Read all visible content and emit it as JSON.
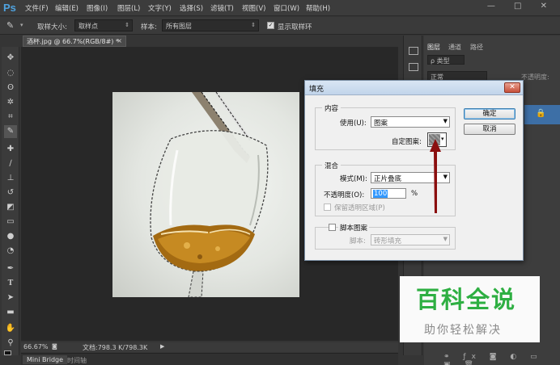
{
  "app": {
    "logo": "Ps"
  },
  "menu": [
    "文件(F)",
    "编辑(E)",
    "图像(I)",
    "图层(L)",
    "文字(Y)",
    "选择(S)",
    "滤镜(T)",
    "视图(V)",
    "窗口(W)",
    "帮助(H)"
  ],
  "window_controls": "— □ ✕",
  "options": {
    "sample_size_label": "取样大小:",
    "sample_size_value": "取样点",
    "sample_label": "样本:",
    "sample_value": "所有图层",
    "show_ring_label": "显示取样环",
    "show_ring_checked": true
  },
  "document_tab": {
    "title": "酒杯.jpg @ 66.7%(RGB/8#) *",
    "close": "×"
  },
  "status": {
    "zoom": "66.67%",
    "doc_info": "文档:798.3 K/798.3K"
  },
  "bottom_tabs": [
    "Mini Bridge",
    "时间轴"
  ],
  "panels": {
    "tabs": [
      "图层",
      "通道",
      "路径"
    ],
    "filter_label": "ρ 类型",
    "blend_mode": "正常",
    "opacity_label": "不透明度:"
  },
  "dialog": {
    "title": "填充",
    "close_glyph": "✕",
    "content_group": "内容",
    "use_label": "使用(U):",
    "use_value": "图案",
    "custom_pattern_label": "自定图案:",
    "blend_group": "混合",
    "mode_label": "模式(M):",
    "mode_value": "正片叠底",
    "opacity_label": "不透明度(O):",
    "opacity_value": "100",
    "opacity_unit": "%",
    "preserve_label": "保留透明区域(P)",
    "script_group": "脚本图案",
    "script_label": "脚本:",
    "script_value": "砖形填充",
    "ok_label": "确定",
    "cancel_label": "取消"
  },
  "watermark": {
    "big": "百科全说",
    "small": "助你轻松解决"
  },
  "colors": {
    "accent_blue": "#3399ff",
    "arrow_red": "#8b0f0f",
    "watermark_green": "#2eaf42"
  }
}
